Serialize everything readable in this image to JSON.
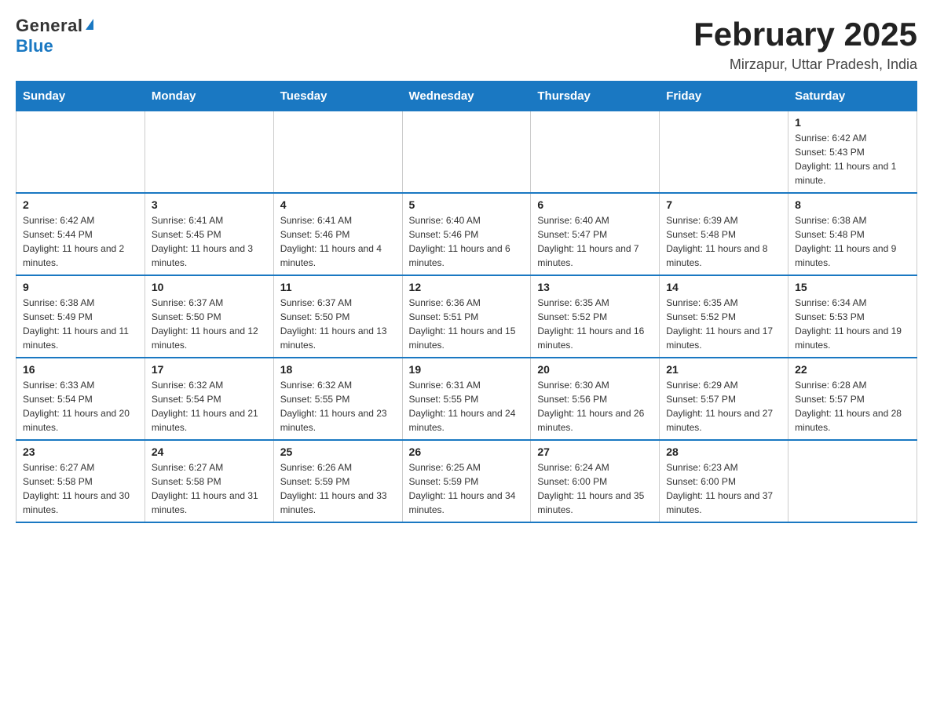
{
  "logo": {
    "general": "General",
    "blue": "Blue"
  },
  "title": "February 2025",
  "subtitle": "Mirzapur, Uttar Pradesh, India",
  "days_of_week": [
    "Sunday",
    "Monday",
    "Tuesday",
    "Wednesday",
    "Thursday",
    "Friday",
    "Saturday"
  ],
  "weeks": [
    [
      {
        "day": "",
        "sunrise": "",
        "sunset": "",
        "daylight": ""
      },
      {
        "day": "",
        "sunrise": "",
        "sunset": "",
        "daylight": ""
      },
      {
        "day": "",
        "sunrise": "",
        "sunset": "",
        "daylight": ""
      },
      {
        "day": "",
        "sunrise": "",
        "sunset": "",
        "daylight": ""
      },
      {
        "day": "",
        "sunrise": "",
        "sunset": "",
        "daylight": ""
      },
      {
        "day": "",
        "sunrise": "",
        "sunset": "",
        "daylight": ""
      },
      {
        "day": "1",
        "sunrise": "Sunrise: 6:42 AM",
        "sunset": "Sunset: 5:43 PM",
        "daylight": "Daylight: 11 hours and 1 minute."
      }
    ],
    [
      {
        "day": "2",
        "sunrise": "Sunrise: 6:42 AM",
        "sunset": "Sunset: 5:44 PM",
        "daylight": "Daylight: 11 hours and 2 minutes."
      },
      {
        "day": "3",
        "sunrise": "Sunrise: 6:41 AM",
        "sunset": "Sunset: 5:45 PM",
        "daylight": "Daylight: 11 hours and 3 minutes."
      },
      {
        "day": "4",
        "sunrise": "Sunrise: 6:41 AM",
        "sunset": "Sunset: 5:46 PM",
        "daylight": "Daylight: 11 hours and 4 minutes."
      },
      {
        "day": "5",
        "sunrise": "Sunrise: 6:40 AM",
        "sunset": "Sunset: 5:46 PM",
        "daylight": "Daylight: 11 hours and 6 minutes."
      },
      {
        "day": "6",
        "sunrise": "Sunrise: 6:40 AM",
        "sunset": "Sunset: 5:47 PM",
        "daylight": "Daylight: 11 hours and 7 minutes."
      },
      {
        "day": "7",
        "sunrise": "Sunrise: 6:39 AM",
        "sunset": "Sunset: 5:48 PM",
        "daylight": "Daylight: 11 hours and 8 minutes."
      },
      {
        "day": "8",
        "sunrise": "Sunrise: 6:38 AM",
        "sunset": "Sunset: 5:48 PM",
        "daylight": "Daylight: 11 hours and 9 minutes."
      }
    ],
    [
      {
        "day": "9",
        "sunrise": "Sunrise: 6:38 AM",
        "sunset": "Sunset: 5:49 PM",
        "daylight": "Daylight: 11 hours and 11 minutes."
      },
      {
        "day": "10",
        "sunrise": "Sunrise: 6:37 AM",
        "sunset": "Sunset: 5:50 PM",
        "daylight": "Daylight: 11 hours and 12 minutes."
      },
      {
        "day": "11",
        "sunrise": "Sunrise: 6:37 AM",
        "sunset": "Sunset: 5:50 PM",
        "daylight": "Daylight: 11 hours and 13 minutes."
      },
      {
        "day": "12",
        "sunrise": "Sunrise: 6:36 AM",
        "sunset": "Sunset: 5:51 PM",
        "daylight": "Daylight: 11 hours and 15 minutes."
      },
      {
        "day": "13",
        "sunrise": "Sunrise: 6:35 AM",
        "sunset": "Sunset: 5:52 PM",
        "daylight": "Daylight: 11 hours and 16 minutes."
      },
      {
        "day": "14",
        "sunrise": "Sunrise: 6:35 AM",
        "sunset": "Sunset: 5:52 PM",
        "daylight": "Daylight: 11 hours and 17 minutes."
      },
      {
        "day": "15",
        "sunrise": "Sunrise: 6:34 AM",
        "sunset": "Sunset: 5:53 PM",
        "daylight": "Daylight: 11 hours and 19 minutes."
      }
    ],
    [
      {
        "day": "16",
        "sunrise": "Sunrise: 6:33 AM",
        "sunset": "Sunset: 5:54 PM",
        "daylight": "Daylight: 11 hours and 20 minutes."
      },
      {
        "day": "17",
        "sunrise": "Sunrise: 6:32 AM",
        "sunset": "Sunset: 5:54 PM",
        "daylight": "Daylight: 11 hours and 21 minutes."
      },
      {
        "day": "18",
        "sunrise": "Sunrise: 6:32 AM",
        "sunset": "Sunset: 5:55 PM",
        "daylight": "Daylight: 11 hours and 23 minutes."
      },
      {
        "day": "19",
        "sunrise": "Sunrise: 6:31 AM",
        "sunset": "Sunset: 5:55 PM",
        "daylight": "Daylight: 11 hours and 24 minutes."
      },
      {
        "day": "20",
        "sunrise": "Sunrise: 6:30 AM",
        "sunset": "Sunset: 5:56 PM",
        "daylight": "Daylight: 11 hours and 26 minutes."
      },
      {
        "day": "21",
        "sunrise": "Sunrise: 6:29 AM",
        "sunset": "Sunset: 5:57 PM",
        "daylight": "Daylight: 11 hours and 27 minutes."
      },
      {
        "day": "22",
        "sunrise": "Sunrise: 6:28 AM",
        "sunset": "Sunset: 5:57 PM",
        "daylight": "Daylight: 11 hours and 28 minutes."
      }
    ],
    [
      {
        "day": "23",
        "sunrise": "Sunrise: 6:27 AM",
        "sunset": "Sunset: 5:58 PM",
        "daylight": "Daylight: 11 hours and 30 minutes."
      },
      {
        "day": "24",
        "sunrise": "Sunrise: 6:27 AM",
        "sunset": "Sunset: 5:58 PM",
        "daylight": "Daylight: 11 hours and 31 minutes."
      },
      {
        "day": "25",
        "sunrise": "Sunrise: 6:26 AM",
        "sunset": "Sunset: 5:59 PM",
        "daylight": "Daylight: 11 hours and 33 minutes."
      },
      {
        "day": "26",
        "sunrise": "Sunrise: 6:25 AM",
        "sunset": "Sunset: 5:59 PM",
        "daylight": "Daylight: 11 hours and 34 minutes."
      },
      {
        "day": "27",
        "sunrise": "Sunrise: 6:24 AM",
        "sunset": "Sunset: 6:00 PM",
        "daylight": "Daylight: 11 hours and 35 minutes."
      },
      {
        "day": "28",
        "sunrise": "Sunrise: 6:23 AM",
        "sunset": "Sunset: 6:00 PM",
        "daylight": "Daylight: 11 hours and 37 minutes."
      },
      {
        "day": "",
        "sunrise": "",
        "sunset": "",
        "daylight": ""
      }
    ]
  ]
}
